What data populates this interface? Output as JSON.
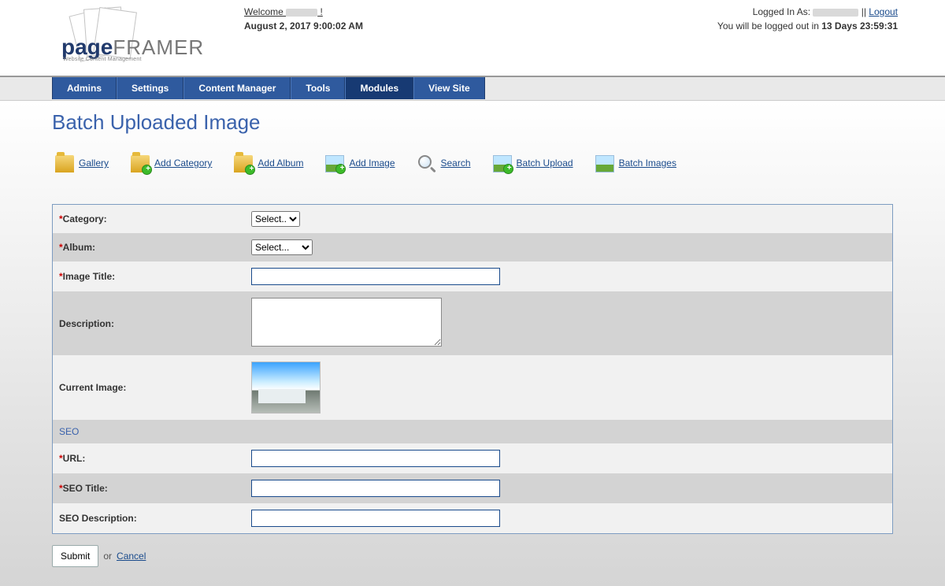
{
  "header": {
    "welcome_prefix": "Welcome ",
    "welcome_suffix": " !",
    "date": "August 2, 2017 9:00:02 AM",
    "logged_in_as_label": "Logged In As: ",
    "separator": " || ",
    "logout": "Logout",
    "logout_warning_prefix": "You will be logged out in ",
    "logout_countdown": "13 Days 23:59:31"
  },
  "logo": {
    "main1": "page",
    "main2": "FRAMER",
    "sub": "Website Content Management"
  },
  "nav": {
    "items": [
      "Admins",
      "Settings",
      "Content Manager",
      "Tools",
      "Modules",
      "View Site"
    ],
    "active_index": 4
  },
  "page": {
    "title": "Batch Uploaded Image"
  },
  "subnav": {
    "items": [
      {
        "label": "Gallery",
        "icon": "folder"
      },
      {
        "label": "Add Category",
        "icon": "folder-plus"
      },
      {
        "label": "Add Album",
        "icon": "folder-plus"
      },
      {
        "label": "Add Image",
        "icon": "pic-plus"
      },
      {
        "label": "Search",
        "icon": "search"
      },
      {
        "label": "Batch Upload",
        "icon": "pic-plus"
      },
      {
        "label": "Batch Images",
        "icon": "pic"
      }
    ]
  },
  "form": {
    "category": {
      "label": "Category:",
      "required": true,
      "placeholder": "Select..."
    },
    "album": {
      "label": "Album:",
      "required": true,
      "placeholder": "Select..."
    },
    "image_title": {
      "label": "Image Title:",
      "required": true,
      "value": ""
    },
    "description": {
      "label": "Description:",
      "required": false,
      "value": ""
    },
    "current_image": {
      "label": "Current Image:",
      "required": false
    },
    "seo_heading": "SEO",
    "url": {
      "label": "URL:",
      "required": true,
      "value": ""
    },
    "seo_title": {
      "label": "SEO Title:",
      "required": true,
      "value": ""
    },
    "seo_description": {
      "label": "SEO Description:",
      "required": false,
      "value": ""
    }
  },
  "actions": {
    "submit": "Submit",
    "or": "or",
    "cancel": "Cancel"
  }
}
